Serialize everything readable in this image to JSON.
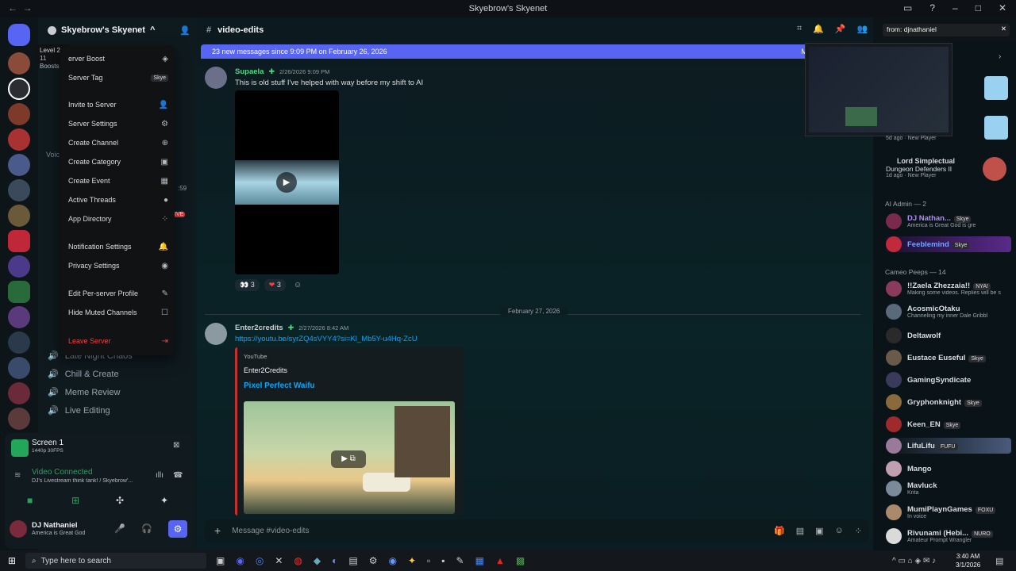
{
  "titlebar": {
    "title": "Skyebrow's Skyenet",
    "back": "←",
    "forward": "→"
  },
  "server": {
    "name": "Skyebrow's Skyenet",
    "level_label": "Level 2",
    "boosts": "11 Boosts"
  },
  "menu": {
    "items": [
      {
        "label": "erver Boost",
        "icon": "◈"
      },
      {
        "label": "Server Tag",
        "badge": "Skye"
      },
      {
        "label": "Invite to Server",
        "icon": "👤"
      },
      {
        "label": "Server Settings",
        "icon": "⚙"
      },
      {
        "label": "Create Channel",
        "icon": "⊕"
      },
      {
        "label": "Create Category",
        "icon": "▣"
      },
      {
        "label": "Create Event",
        "icon": "▦"
      },
      {
        "label": "Active Threads",
        "icon": "●"
      },
      {
        "label": "App Directory",
        "icon": "⁘"
      },
      {
        "label": "Notification Settings",
        "icon": "🔔"
      },
      {
        "label": "Privacy Settings",
        "icon": "◉"
      },
      {
        "label": "Edit Per-server Profile",
        "icon": "✎"
      },
      {
        "label": "Hide Muted Channels",
        "icon": "☐"
      },
      {
        "label": "Leave Server",
        "icon": "⇥"
      }
    ]
  },
  "channels": {
    "voice_items": [
      "Late Night Chaos",
      "Chill & Create",
      "Meme Review",
      "Live Editing"
    ],
    "partial": "Voic",
    "time": ":59",
    "live": "IVE"
  },
  "voice_panel": {
    "screen": "Screen 1",
    "screen_sub": "1440p 30FPS",
    "connected": "Video Connected",
    "stream": "DJ's Livestream think tank! / Skyebrow'...",
    "user": "DJ Nathaniel",
    "status": "America is Great God"
  },
  "channel_header": {
    "name": "video-edits",
    "search": "from: djnathaniel"
  },
  "new_messages": "23 new messages since 9:09 PM on February 26, 2026",
  "new_messages_right": "M",
  "messages": [
    {
      "author": "Supaela",
      "time": "2/26/2026 9:09 PM",
      "text": "This is old stuff I've helped with way before my shift to AI",
      "reactions": [
        {
          "emoji": "👀",
          "count": "3"
        },
        {
          "emoji": "❤",
          "count": "3"
        }
      ]
    },
    {
      "author": "Enter2credits",
      "time": "2/27/2026 8:42 AM",
      "link": "https://youtu.be/syrZQ4sVYY4?si=Kl_Mb5Y-u4Hq-ZcU",
      "embed_source": "YouTube",
      "embed_author": "Enter2Credits",
      "embed_title": "Pixel Perfect Waifu"
    }
  ],
  "divider_date": "February 27, 2026",
  "composer_placeholder": "Message #video-edits",
  "members": {
    "top": [
      {
        "name": "",
        "sub": "5d ago · New Player"
      },
      {
        "name": "Lord Simplectual",
        "game": "Dungeon Defenders II",
        "sub": "1d ago · New Player"
      }
    ],
    "ai_admin_header": "AI Admin — 2",
    "ai_admin": [
      {
        "name": "DJ Nathan...",
        "tag": "Skye",
        "sub": "America is Great God is gre",
        "color": "#b388ff"
      },
      {
        "name": "Feeblemind",
        "tag": "Skye",
        "sub": "",
        "color": "#7aa2ff"
      }
    ],
    "cameo_header": "Cameo Peeps — 14",
    "cameo": [
      {
        "name": "!!Zaela Zhezzaia!!",
        "tag": "NYA!",
        "sub": "Making some videos. Replies will be s"
      },
      {
        "name": "AcosmicOtaku",
        "tag": "",
        "sub": "Channeling my inner Dale Gribbl"
      },
      {
        "name": "Deltawolf",
        "tag": "",
        "sub": ""
      },
      {
        "name": "Eustace Euseful",
        "tag": "Skye",
        "sub": ""
      },
      {
        "name": "GamingSyndicate",
        "tag": "",
        "sub": ""
      },
      {
        "name": "Gryphonknight",
        "tag": "Skye",
        "sub": ""
      },
      {
        "name": "Keen_EN",
        "tag": "Skye",
        "sub": ""
      },
      {
        "name": "LifuLifu",
        "tag": "FUFU",
        "sub": ""
      },
      {
        "name": "Mango",
        "tag": "",
        "sub": ""
      },
      {
        "name": "Mavluck",
        "tag": "",
        "sub": "Krita"
      },
      {
        "name": "MumiPlaynGames",
        "tag": "FOXU",
        "sub": "In voice"
      },
      {
        "name": "Rivunami (Hebi...",
        "tag": "NURO",
        "sub": "Amateur Prompt Wrangler"
      }
    ]
  },
  "taskbar": {
    "search": "Type here to search",
    "time": "3:40 AM",
    "date": "3/1/2026"
  },
  "colors": {
    "accent": "#5865f2",
    "online": "#23a55a"
  }
}
